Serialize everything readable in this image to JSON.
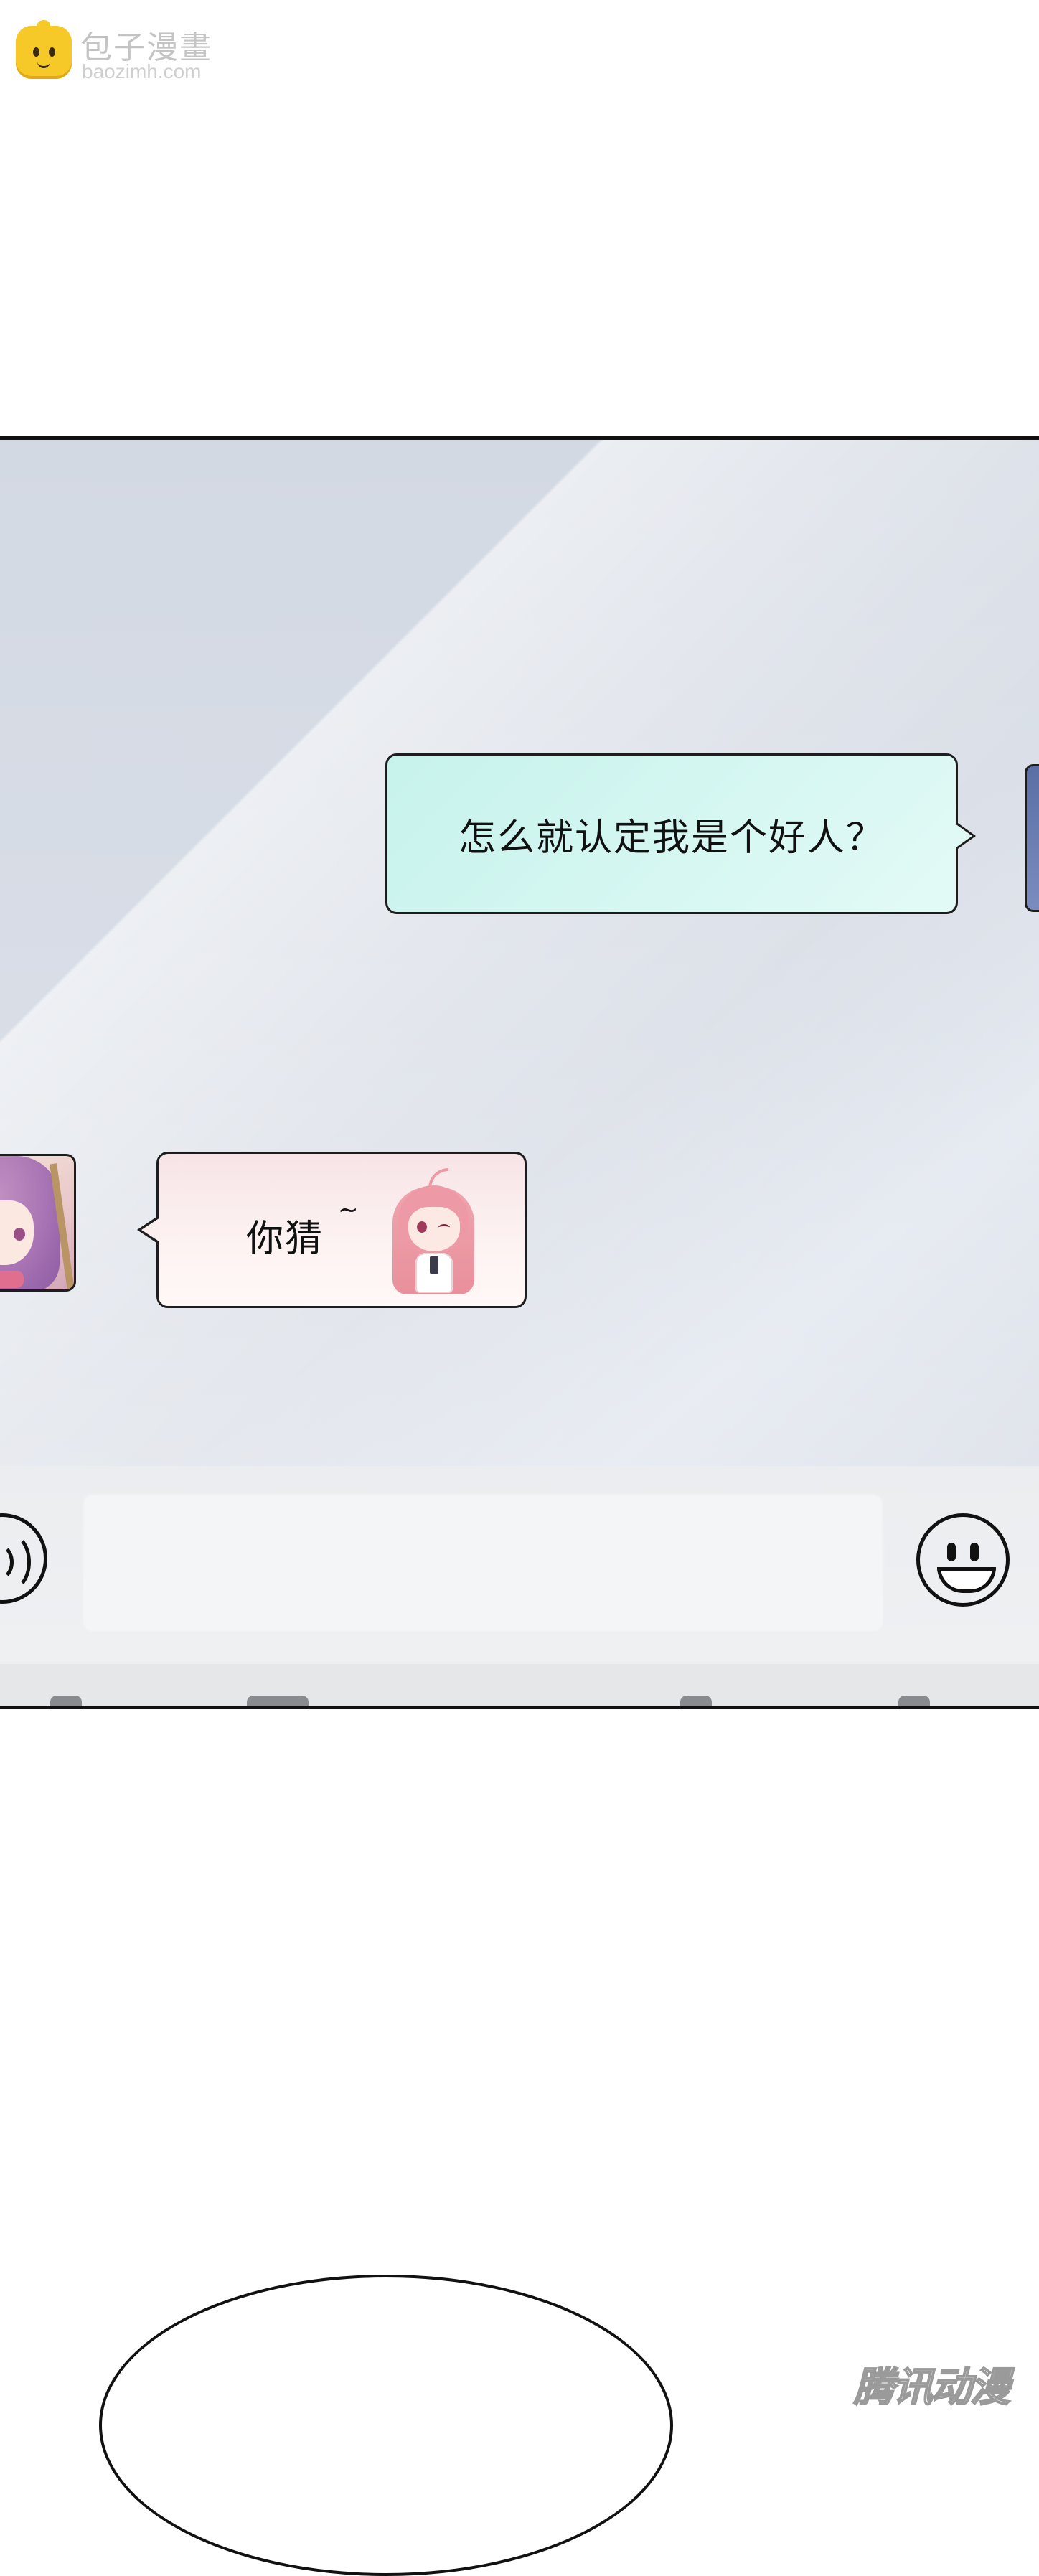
{
  "watermark_top": {
    "title": "包子漫畫",
    "url": "baozimh.com",
    "icon": "bun-face-icon"
  },
  "chat": {
    "outgoing_message": "怎么就认定我是个好人？",
    "incoming_message": "你猜",
    "incoming_tilde": "~",
    "sticker_icon": "chibi-wink-sticker"
  },
  "input_bar": {
    "voice_icon": "voice-icon",
    "text_value": "",
    "emoji_icon": "emoji-icon"
  },
  "watermark_bottom": {
    "text": "腾讯动漫"
  },
  "colors": {
    "outgoing_bubble": "#d6f7f2",
    "incoming_bubble": "#fdf3f2",
    "panel_bg": "#d8dde6",
    "logo_yellow": "#f6c928"
  }
}
